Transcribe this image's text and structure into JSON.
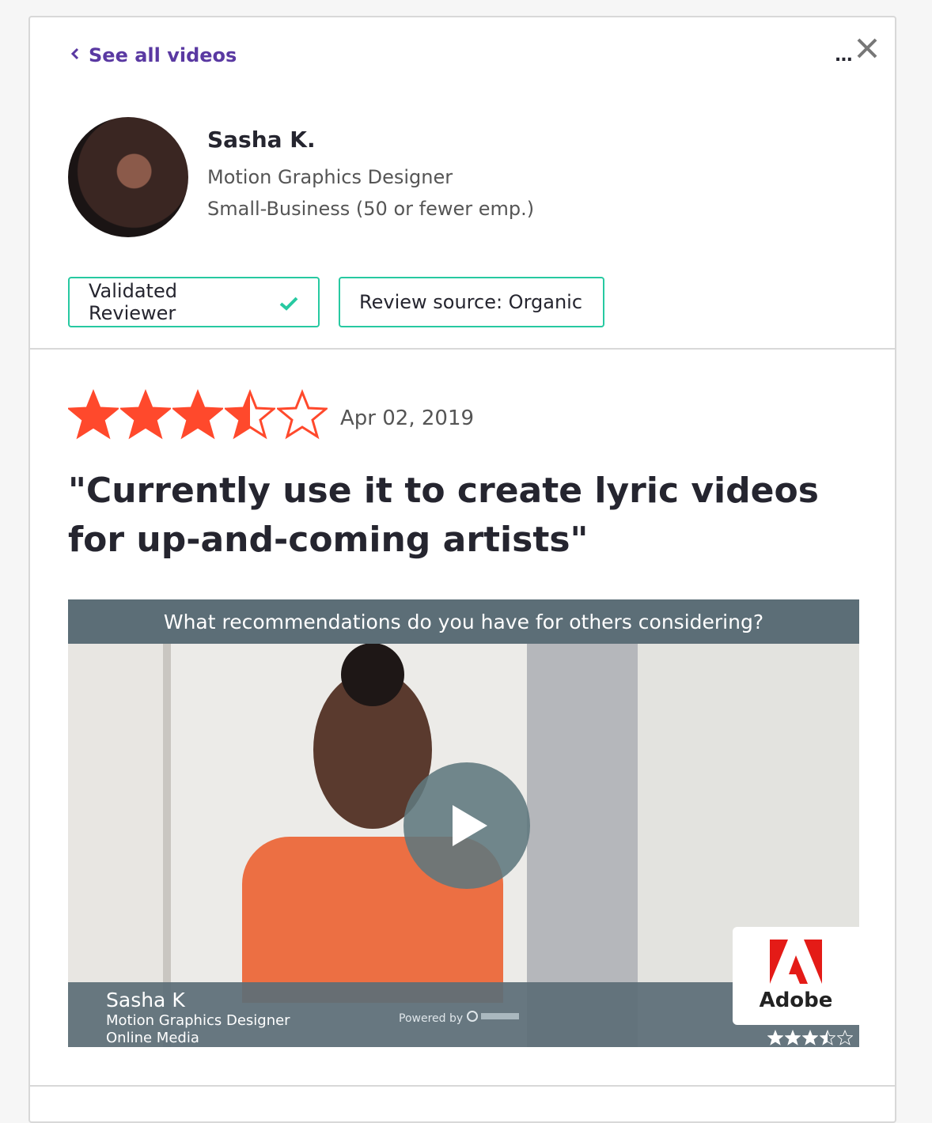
{
  "nav": {
    "back_label": "See all videos",
    "more_label": "..."
  },
  "reviewer": {
    "name": "Sasha K.",
    "title": "Motion Graphics Designer",
    "company_size": "Small-Business (50 or fewer emp.)"
  },
  "badges": {
    "validated": "Validated Reviewer",
    "source": "Review source: Organic"
  },
  "review": {
    "rating": 3.5,
    "max_rating": 5,
    "date": "Apr 02, 2019",
    "headline": "\"Currently use it to create lyric videos for up-and-coming artists\""
  },
  "video": {
    "question": "What recommendations do you have for others considering?",
    "person_name": "Sasha K",
    "person_title": "Motion Graphics Designer",
    "person_org": "Online Media",
    "powered_by": "Powered by",
    "brand_name": "Adobe",
    "rating": 3.5
  },
  "colors": {
    "star": "#ff492c",
    "accent_purple": "#5a39a2",
    "badge_border": "#27c9a1"
  }
}
